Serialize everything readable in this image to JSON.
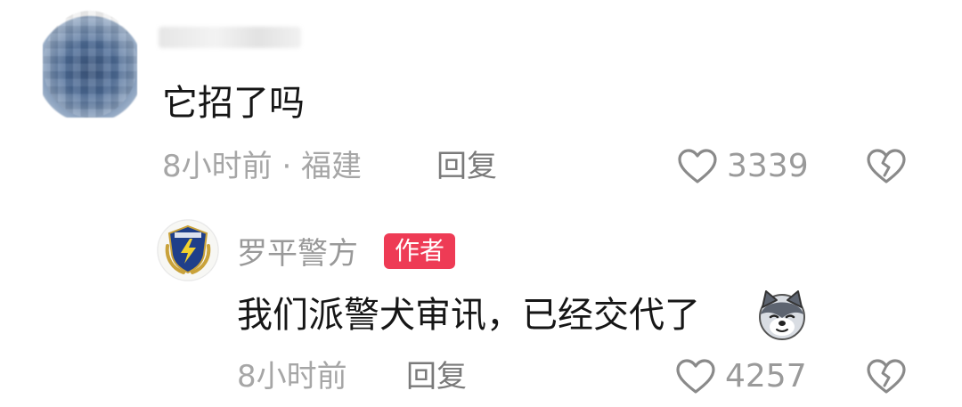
{
  "comments": [
    {
      "text": "它招了吗",
      "time": "8小时前 · 福建",
      "reply_label": "回复",
      "likes": "3339"
    },
    {
      "author": "罗平警方",
      "badge": "作者",
      "text": "我们派警犬审讯，已经交代了",
      "time": "8小时前",
      "reply_label": "回复",
      "likes": "4257"
    }
  ],
  "icons": {
    "like": "heart-outline-icon",
    "dislike": "broken-heart-outline-icon",
    "emoji": "husky-dog-emoji"
  },
  "colors": {
    "badge_bg": "#ee3b55",
    "meta_text": "#a6a6a6",
    "main_text": "#161616"
  }
}
